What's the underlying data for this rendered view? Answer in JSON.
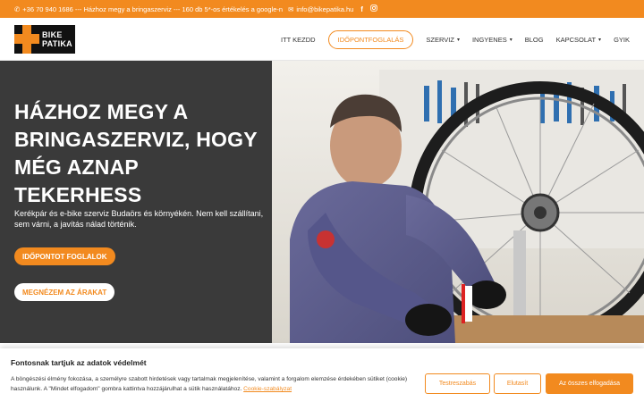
{
  "topbar": {
    "phone": "+36 70 940 1686 --- Házhoz megy a bringaszerviz --- 160 db 5*-os értékelés a google-n",
    "email": "info@bikepatika.hu",
    "facebook_icon": "facebook-icon",
    "instagram_icon": "instagram-icon"
  },
  "logo": {
    "line1": "BIKE",
    "line2": "PATIKA"
  },
  "nav": {
    "home": "ITT KEZDD",
    "booking": "IDŐPONTFOGLALÁS",
    "service": "SZERVIZ",
    "free": "INGYENES",
    "blog": "BLOG",
    "contact": "KAPCSOLAT",
    "faq": "GYIK"
  },
  "hero": {
    "title": "HÁZHOZ MEGY A BRINGASZERVIZ, HOGY MÉG AZNAP TEKERHESS",
    "subtitle": "Kerékpár és e-bike szerviz Budaörs és környékén. Nem kell szállítani, sem várni, a javítás nálad történik.",
    "btn_primary": "IDŐPONTOT FOGLALOK",
    "btn_secondary": "MEGNÉZEM AZ ÁRAKAT"
  },
  "cookie": {
    "title": "Fontosnak tartjuk az adatok védelmét",
    "text": "A böngészési élmény fokozása, a személyre szabott hirdetések vagy tartalmak megjelenítése, valamint a forgalom elemzése érdekében sütiket (cookie) használunk. A \"Mindet elfogadom\" gombra kattintva hozzájárulhat a sütik használatához.",
    "link": "Cookie-szabályzat",
    "customize": "Testreszabás",
    "reject": "Elutasít",
    "accept_all": "Az összes elfogadása"
  },
  "colors": {
    "accent": "#f28a1f",
    "dark": "#3a3a3a"
  }
}
